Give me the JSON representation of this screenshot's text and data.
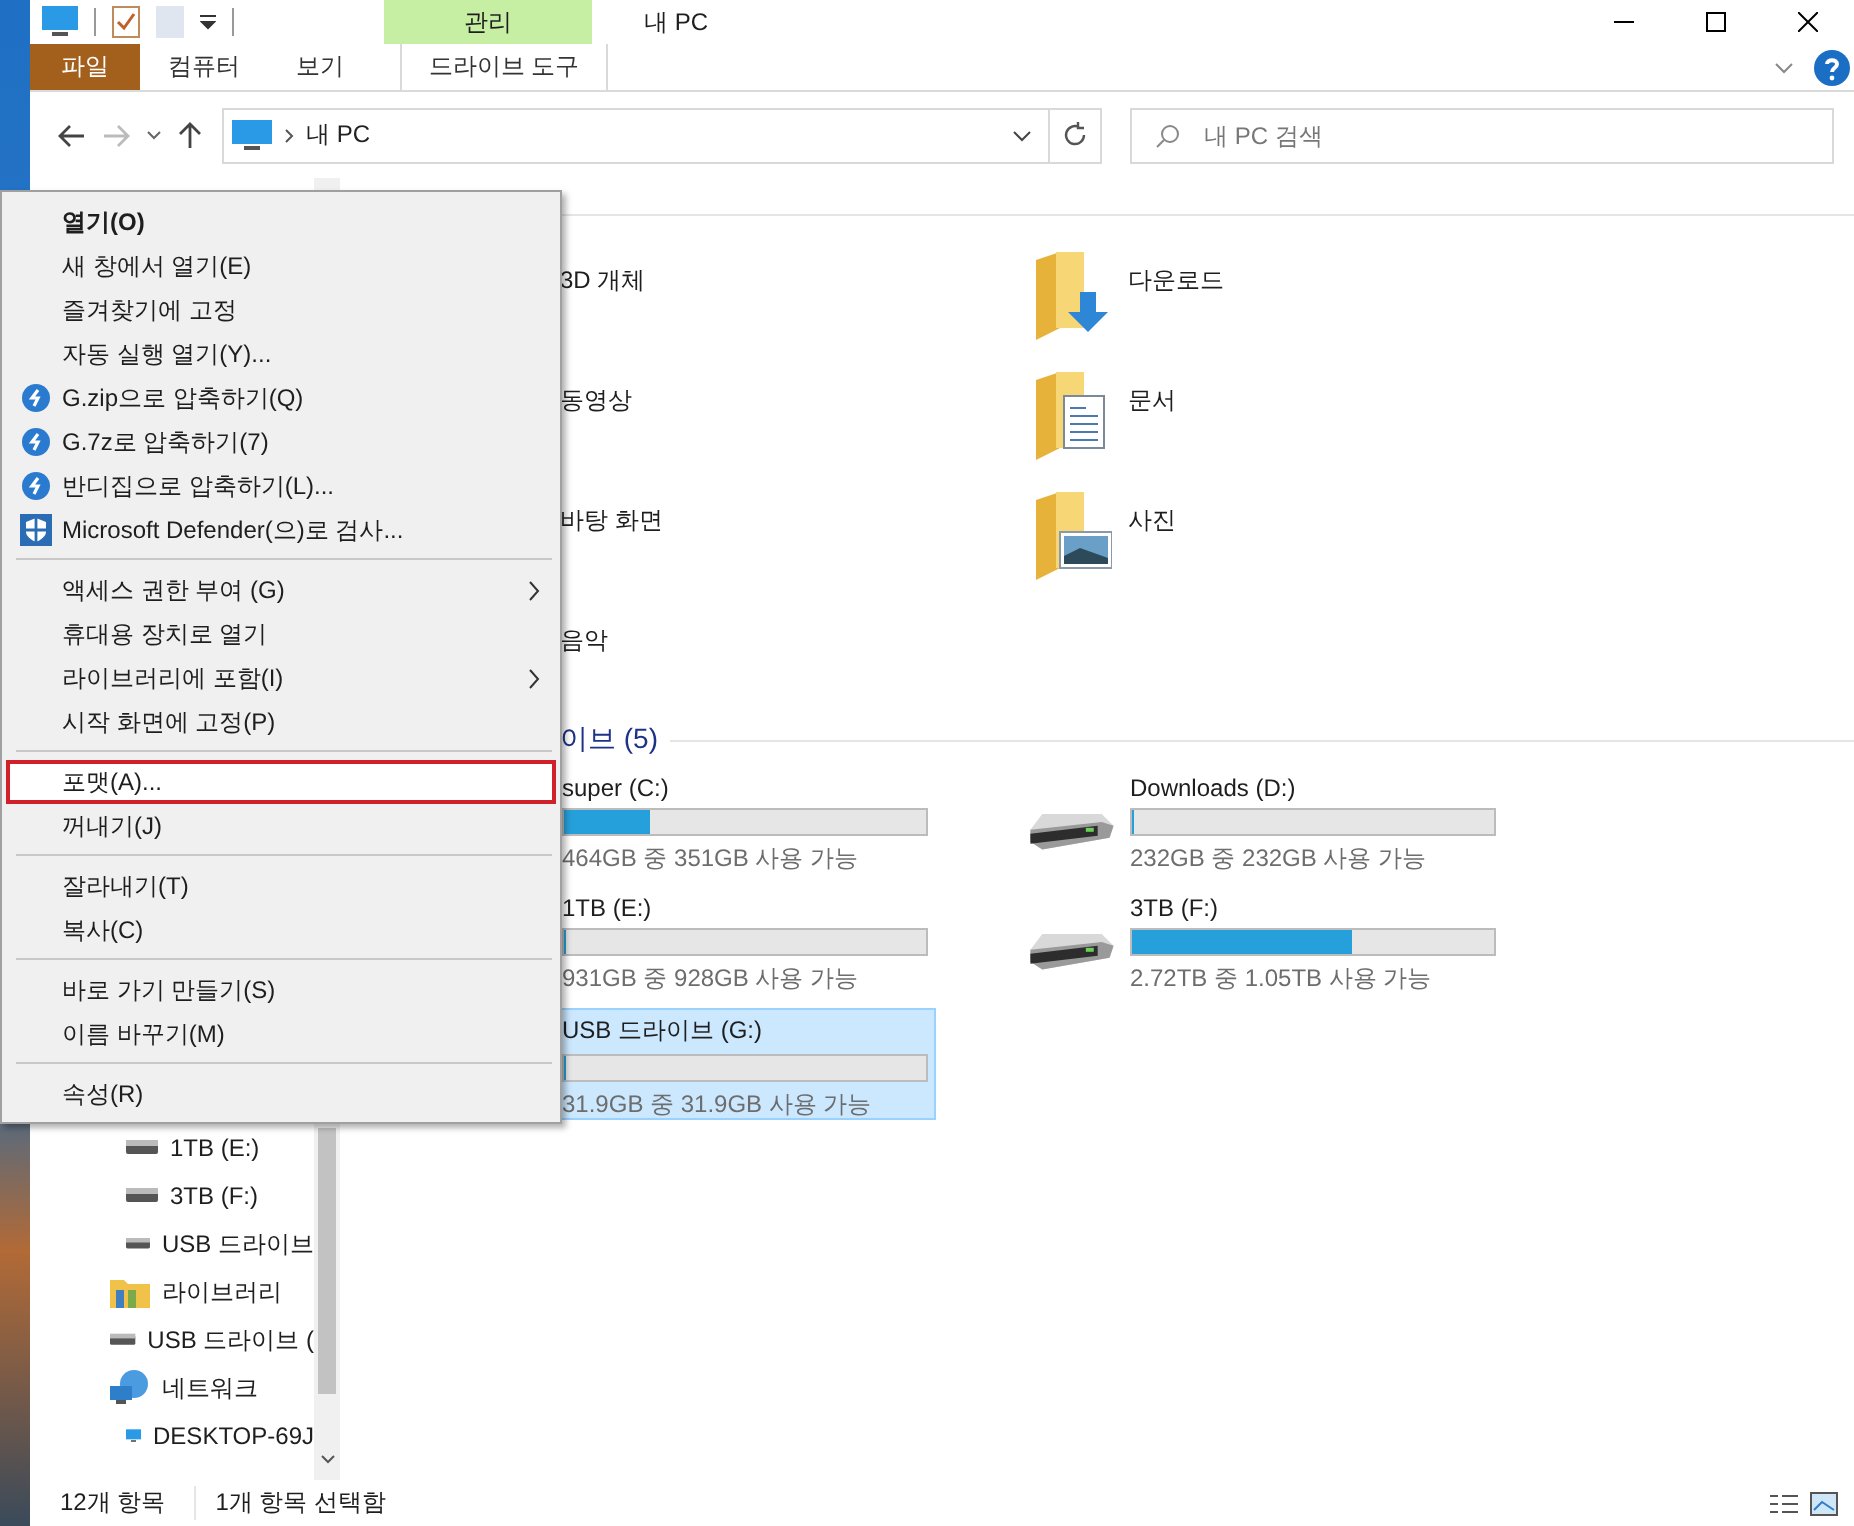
{
  "window": {
    "title": "내 PC",
    "context_tab_group": "관리"
  },
  "ribbon_tabs": [
    {
      "label": "파일",
      "kind": "file"
    },
    {
      "label": "컴퓨터",
      "kind": "tab"
    },
    {
      "label": "보기",
      "kind": "tab"
    },
    {
      "label": "드라이브 도구",
      "kind": "context"
    }
  ],
  "address_bar": {
    "path": "내 PC"
  },
  "search": {
    "placeholder": "내 PC 검색"
  },
  "navigation_pane": {
    "continued_children": [
      {
        "label": "1TB (E:)",
        "kind": "drive"
      },
      {
        "label": "3TB (F:)",
        "kind": "drive"
      },
      {
        "label": "USB 드라이브",
        "kind": "drive"
      }
    ],
    "items": [
      {
        "label": "라이브러리",
        "kind": "library"
      },
      {
        "label": "USB 드라이브 (",
        "kind": "drive"
      },
      {
        "label": "네트워크",
        "kind": "network",
        "children": [
          {
            "label": "DESKTOP-69J",
            "kind": "computer"
          }
        ]
      }
    ]
  },
  "folders": [
    {
      "name": "3D 개체",
      "kind": "covered"
    },
    {
      "name": "다운로드",
      "kind": "download"
    },
    {
      "name": "동영상",
      "kind": "covered"
    },
    {
      "name": "문서",
      "kind": "documents"
    },
    {
      "name": "바탕 화면",
      "kind": "covered"
    },
    {
      "name": "사진",
      "kind": "pictures"
    },
    {
      "name": "음악",
      "kind": "covered"
    }
  ],
  "drives_header": "이브 (5)",
  "drives": [
    {
      "name": "super (C:)",
      "usage": "464GB 중 351GB 사용 가능",
      "level": 0.24,
      "kind": "covered",
      "selected": false
    },
    {
      "name": "Downloads (D:)",
      "usage": "232GB 중 232GB 사용 가능",
      "level": 0,
      "kind": "hdd",
      "selected": false
    },
    {
      "name": "1TB (E:)",
      "usage": "931GB 중 928GB 사용 가능",
      "level": 0.003,
      "kind": "covered",
      "selected": false
    },
    {
      "name": "3TB (F:)",
      "usage": "2.72TB 중 1.05TB 사용 가능",
      "level": 0.61,
      "kind": "hdd",
      "selected": false
    },
    {
      "name": "USB 드라이브 (G:)",
      "usage": "31.9GB 중 31.9GB 사용 가능",
      "level": 0,
      "kind": "covered",
      "selected": true
    }
  ],
  "context_menu": [
    [
      {
        "label": "열기(O)",
        "kind": "default",
        "submenu": false,
        "selected": false
      },
      {
        "label": "새 창에서 열기(E)",
        "kind": "plain",
        "submenu": false,
        "selected": false
      },
      {
        "label": "즐겨찾기에 고정",
        "kind": "plain",
        "submenu": false,
        "selected": false
      },
      {
        "label": "자동 실행 열기(Y)...",
        "kind": "plain",
        "submenu": false,
        "selected": false
      },
      {
        "label": "G.zip으로 압축하기(Q)",
        "kind": "compress",
        "submenu": false,
        "selected": false
      },
      {
        "label": "G.7z로 압축하기(7)",
        "kind": "compress",
        "submenu": false,
        "selected": false
      },
      {
        "label": "반디집으로 압축하기(L)...",
        "kind": "compress",
        "submenu": false,
        "selected": false
      },
      {
        "label": "Microsoft Defender(으)로 검사...",
        "kind": "defender",
        "submenu": false,
        "selected": false
      }
    ],
    [
      {
        "label": "액세스 권한 부여 (G)",
        "kind": "plain",
        "submenu": true,
        "selected": false
      },
      {
        "label": "휴대용 장치로 열기",
        "kind": "plain",
        "submenu": false,
        "selected": false
      },
      {
        "label": "라이브러리에 포함(I)",
        "kind": "plain",
        "submenu": true,
        "selected": false
      },
      {
        "label": "시작 화면에 고정(P)",
        "kind": "plain",
        "submenu": false,
        "selected": false
      }
    ],
    [
      {
        "label": "포맷(A)...",
        "kind": "plain",
        "submenu": false,
        "selected": true
      },
      {
        "label": "꺼내기(J)",
        "kind": "plain",
        "submenu": false,
        "selected": false
      }
    ],
    [
      {
        "label": "잘라내기(T)",
        "kind": "plain",
        "submenu": false,
        "selected": false
      },
      {
        "label": "복사(C)",
        "kind": "plain",
        "submenu": false,
        "selected": false
      }
    ],
    [
      {
        "label": "바로 가기 만들기(S)",
        "kind": "plain",
        "submenu": false,
        "selected": false
      },
      {
        "label": "이름 바꾸기(M)",
        "kind": "plain",
        "submenu": false,
        "selected": false
      }
    ],
    [
      {
        "label": "속성(R)",
        "kind": "plain",
        "submenu": false,
        "selected": false
      }
    ]
  ],
  "status_bar": {
    "item_count": "12개 항목",
    "selection": "1개 항목 선택함"
  }
}
